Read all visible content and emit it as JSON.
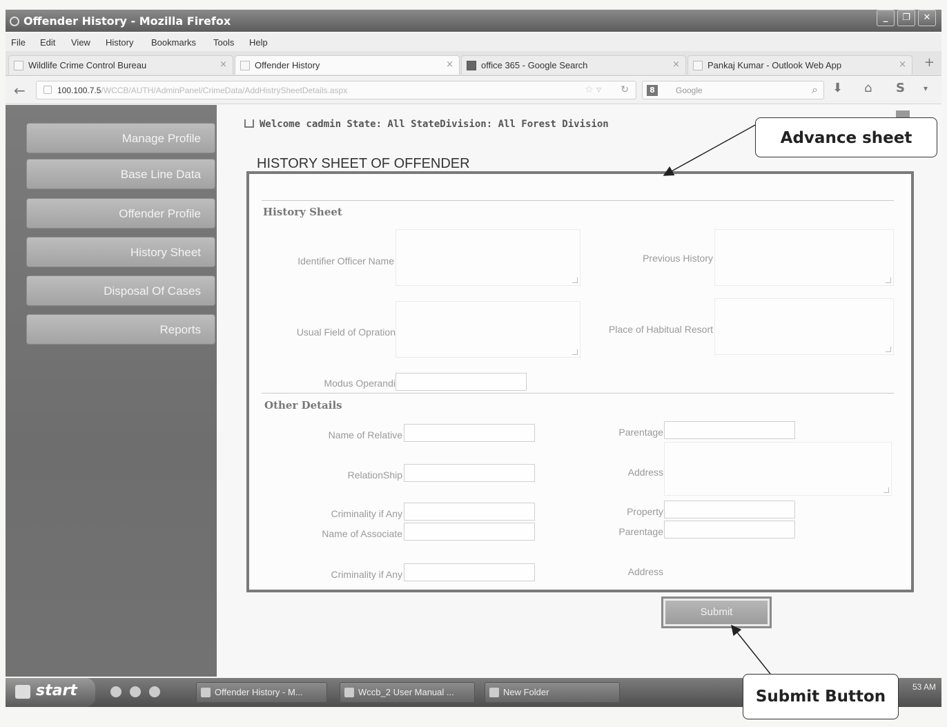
{
  "window": {
    "title": "Offender History - Mozilla Firefox",
    "controls": [
      "minimize",
      "restore",
      "close"
    ]
  },
  "menu": [
    "File",
    "Edit",
    "View",
    "History",
    "Bookmarks",
    "Tools",
    "Help"
  ],
  "tabs": [
    {
      "label": "Wildlife Crime Control Bureau",
      "active": false
    },
    {
      "label": "Offender History",
      "active": true
    },
    {
      "label": "office 365 - Google Search",
      "active": false
    },
    {
      "label": "Pankaj Kumar - Outlook Web App",
      "active": false
    }
  ],
  "nav": {
    "url_host": "100.100.7.5",
    "url_path": "/WCCB/AUTH/AdminPanel/CrimeData/AddHistrySheetDetails.aspx",
    "search_placeholder": "Google"
  },
  "sidebar": {
    "items": [
      "Manage Profile",
      "Base Line Data",
      "Offender Profile",
      "History Sheet",
      "Disposal Of Cases",
      "Reports"
    ]
  },
  "welcome": "Welcome cadmin State: All StateDivision: All Forest Division",
  "page_title": "HISTORY SHEET OF OFFENDER",
  "form": {
    "history_section": "History Sheet",
    "identifier_officer_name": "Identifier Officer Name",
    "previous_history": "Previous History",
    "usual_field": "Usual Field of Opration",
    "place_habitual": "Place of Habitual Resort",
    "modus_operandi": "Modus Operandi",
    "other_section": "Other Details",
    "name_of_relative": "Name of Relative",
    "parentage": "Parentage",
    "relationship": "RelationShip",
    "address": "Address",
    "criminality": "Criminality if Any",
    "property": "Property",
    "name_of_associate": "Name of Associate",
    "parentage2": "Parentage",
    "criminality2": "Criminality if Any",
    "address2": "Address"
  },
  "submit_label": "Submit",
  "callouts": {
    "advance_sheet": "Advance sheet",
    "submit_button": "Submit Button"
  },
  "taskbar": {
    "start": "start",
    "items": [
      "Offender History - M...",
      "Wccb_2 User Manual ...",
      "New Folder"
    ],
    "clock": "53 AM"
  }
}
